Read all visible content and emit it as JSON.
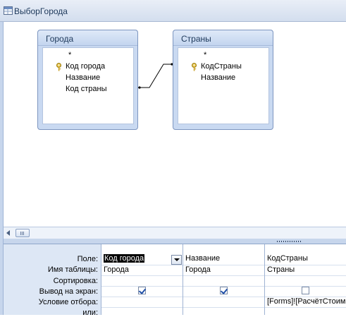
{
  "window": {
    "title": "ВыборГорода",
    "accent": "#1e395b"
  },
  "tables": [
    {
      "name": "Города",
      "fields": [
        "*",
        "Код города",
        "Название",
        "Код страны"
      ],
      "key_field": "Код города"
    },
    {
      "name": "Страны",
      "fields": [
        "*",
        "КодСтраны",
        "Название"
      ],
      "key_field": "КодСтраны"
    }
  ],
  "relationship": {
    "from": "Код страны",
    "to": "КодСтраны"
  },
  "grid": {
    "row_labels": [
      "Поле:",
      "Имя таблицы:",
      "Сортировка:",
      "Вывод на экран:",
      "Условие отбора:",
      "или:"
    ],
    "columns": [
      {
        "field": "Код города",
        "table": "Города",
        "sort": "",
        "show": true,
        "criteria": "",
        "or": ""
      },
      {
        "field": "Название",
        "table": "Города",
        "sort": "",
        "show": true,
        "criteria": "",
        "or": ""
      },
      {
        "field": "КодСтраны",
        "table": "Страны",
        "sort": "",
        "show": false,
        "criteria": "[Forms]![РасчётСтоим",
        "or": ""
      }
    ]
  },
  "icons": {
    "title": "query-icon",
    "key": "primary-key-icon"
  }
}
